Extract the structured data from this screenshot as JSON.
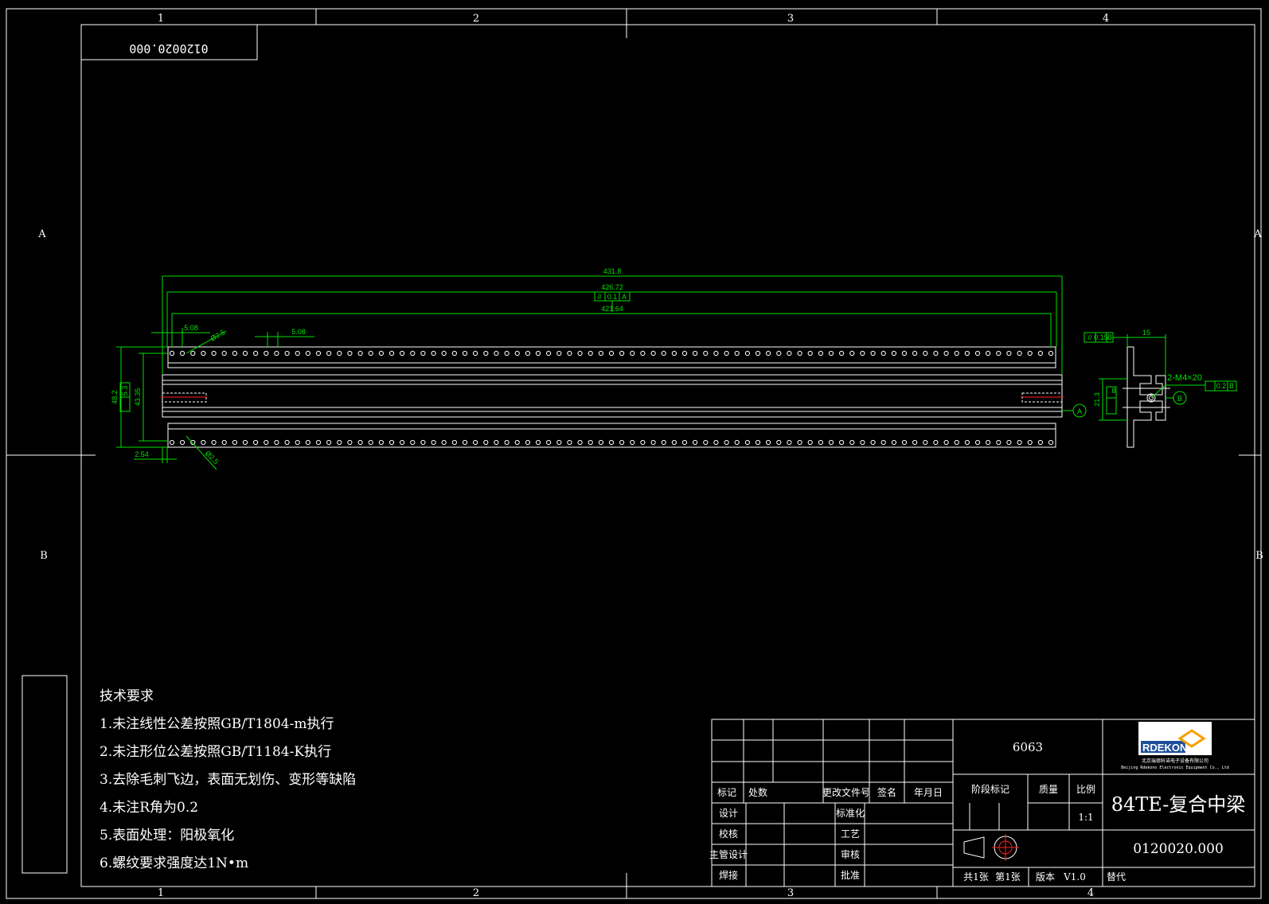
{
  "drawing": {
    "number_mirrored": "0120020.000",
    "zone_columns": [
      "1",
      "2",
      "3",
      "4"
    ],
    "zone_rows": [
      "A",
      "B"
    ],
    "colors": {
      "background": "#000000",
      "line": "#ffffff",
      "dimension": "#00e000",
      "centerline": "#ff2020"
    }
  },
  "dimensions": {
    "overall_length": "431.8",
    "length_2": "426.72",
    "length_3": "421.64",
    "parallelism": "//",
    "parallelism_value": "0.1",
    "parallelism_datum": "A",
    "pitch_left": "5.08",
    "pitch_mid": "5.08",
    "hole_dia_top": "Ø2.5",
    "hole_dia_bottom": "Ø2.5",
    "height_total": "48.2",
    "height_inner": "43.35",
    "height_small": "5.3",
    "edge_offset": "2.54",
    "datum_a": "A",
    "side_width": "15",
    "side_height": "21.3",
    "side_small": "8",
    "side_flatness": "//",
    "side_flatness_value": "0.15",
    "side_flatness_datum": "B",
    "thread_callout": "2-M4×20",
    "thread_tol_value": "0.2",
    "thread_tol_datum": "B",
    "datum_b": "B"
  },
  "notes": {
    "title": "技术要求",
    "items": [
      "1.未注线性公差按照GB/T1804-m执行",
      "2.未注形位公差按照GB/T1184-K执行",
      "3.去除毛刺飞边，表面无划伤、变形等缺陷",
      "4.未注R角为0.2",
      "5.表面处理：阳极氧化",
      "6.螺纹要求强度达1N•m"
    ]
  },
  "title_block": {
    "material": "6063",
    "col_mark": "标记",
    "col_count": "处数",
    "col_change_doc": "更改文件号",
    "col_sign": "签名",
    "col_date": "年月日",
    "design": "设计",
    "check": "校核",
    "lead_design": "主管设计",
    "weld": "焊接",
    "standardize": "标准化",
    "process": "工艺",
    "review": "审核",
    "approve": "批准",
    "stage_mark": "阶段标记",
    "mass": "质量",
    "ratio": "比例",
    "ratio_value": "1:1",
    "part_name": "84TE-复合中梁",
    "part_number": "0120020.000",
    "sheets_total": "共1张",
    "sheet_no": "第1张",
    "version_label": "版本",
    "version_value": "V1.0",
    "replaces": "替代",
    "company_logo": "RDEKONO",
    "company_cn": "北京瑞德科诺电子设备有限公司",
    "company_en": "Beijing Rdekono Electronic Equipment Co., Ltd"
  }
}
